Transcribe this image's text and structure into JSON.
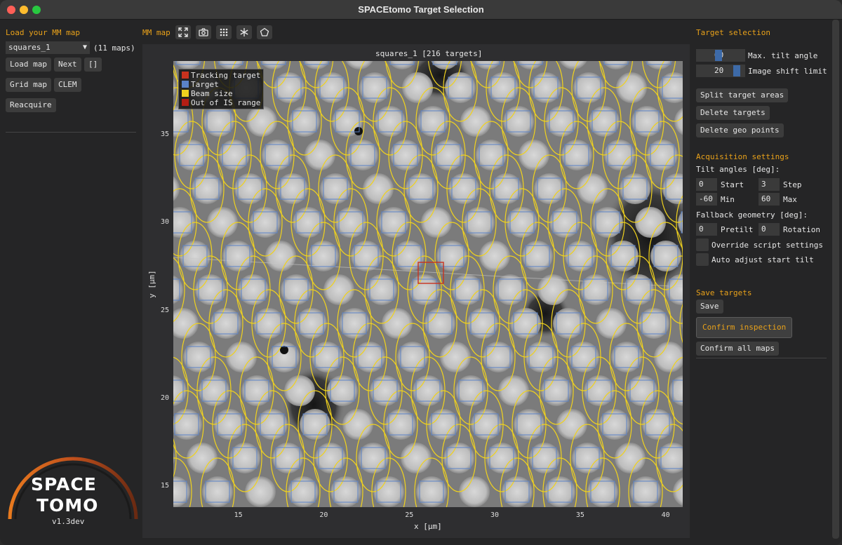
{
  "window": {
    "title": "SPACEtomo Target Selection"
  },
  "left": {
    "title": "Load your MM map",
    "map_select": "squares_1",
    "map_count": "(11 maps)",
    "buttons": {
      "load_map": "Load map",
      "next": "Next",
      "brackets": "[]",
      "grid_map": "Grid map",
      "clem": "CLEM",
      "reacquire": "Reacquire"
    },
    "logo": {
      "line1": "SPACE",
      "line2": "TOMO",
      "version": "v1.3dev"
    }
  },
  "toolbar": {
    "label": "MM map",
    "icons": [
      "fullscreen-icon",
      "camera-icon",
      "grid-icon",
      "snowflake-icon",
      "pentagon-icon"
    ]
  },
  "plot": {
    "title": "squares_1 [216 targets]",
    "legend": [
      {
        "label": "Tracking target",
        "color": "#c8321e"
      },
      {
        "label": "Target",
        "color": "#5a82c8"
      },
      {
        "label": "Beam size",
        "color": "#f0d21e"
      },
      {
        "label": "Out of IS range",
        "color": "#b41e14"
      }
    ],
    "xlabel": "x [µm]",
    "ylabel": "y [µm]",
    "xticks": [
      "15",
      "20",
      "25",
      "30",
      "35",
      "40"
    ],
    "yticks": [
      "35",
      "30",
      "25",
      "20",
      "15"
    ],
    "xlim": [
      11.2,
      41.0
    ],
    "ylim": [
      13.8,
      39.2
    ],
    "colors": {
      "beam": "#f0d21e",
      "target": "#5a82c8",
      "tracking": "#c8321e"
    }
  },
  "right": {
    "title": "Target selection",
    "max_tilt": {
      "value": "60",
      "label": "Max. tilt angle",
      "fill": 0.45
    },
    "is_limit": {
      "value": "20",
      "label": "Image shift limit",
      "fill": 0.9
    },
    "buttons": {
      "split": "Split target areas",
      "delete_targets": "Delete targets",
      "delete_geo": "Delete geo points"
    },
    "acq_title": "Acquisition settings",
    "tilt_label": "Tilt angles [deg]:",
    "start": {
      "value": "0",
      "label": "Start"
    },
    "step": {
      "value": "3",
      "label": "Step"
    },
    "min": {
      "value": "-60",
      "label": "Min"
    },
    "max": {
      "value": "60",
      "label": "Max"
    },
    "fallback_label": "Fallback geometry [deg]:",
    "pretilt": {
      "value": "0",
      "label": "Pretilt"
    },
    "rotation": {
      "value": "0",
      "label": "Rotation"
    },
    "override_label": "Override script settings",
    "auto_label": "Auto adjust start tilt",
    "save_title": "Save targets",
    "save": "Save",
    "confirm": "Confirm inspection",
    "confirm_all": "Confirm all maps"
  }
}
